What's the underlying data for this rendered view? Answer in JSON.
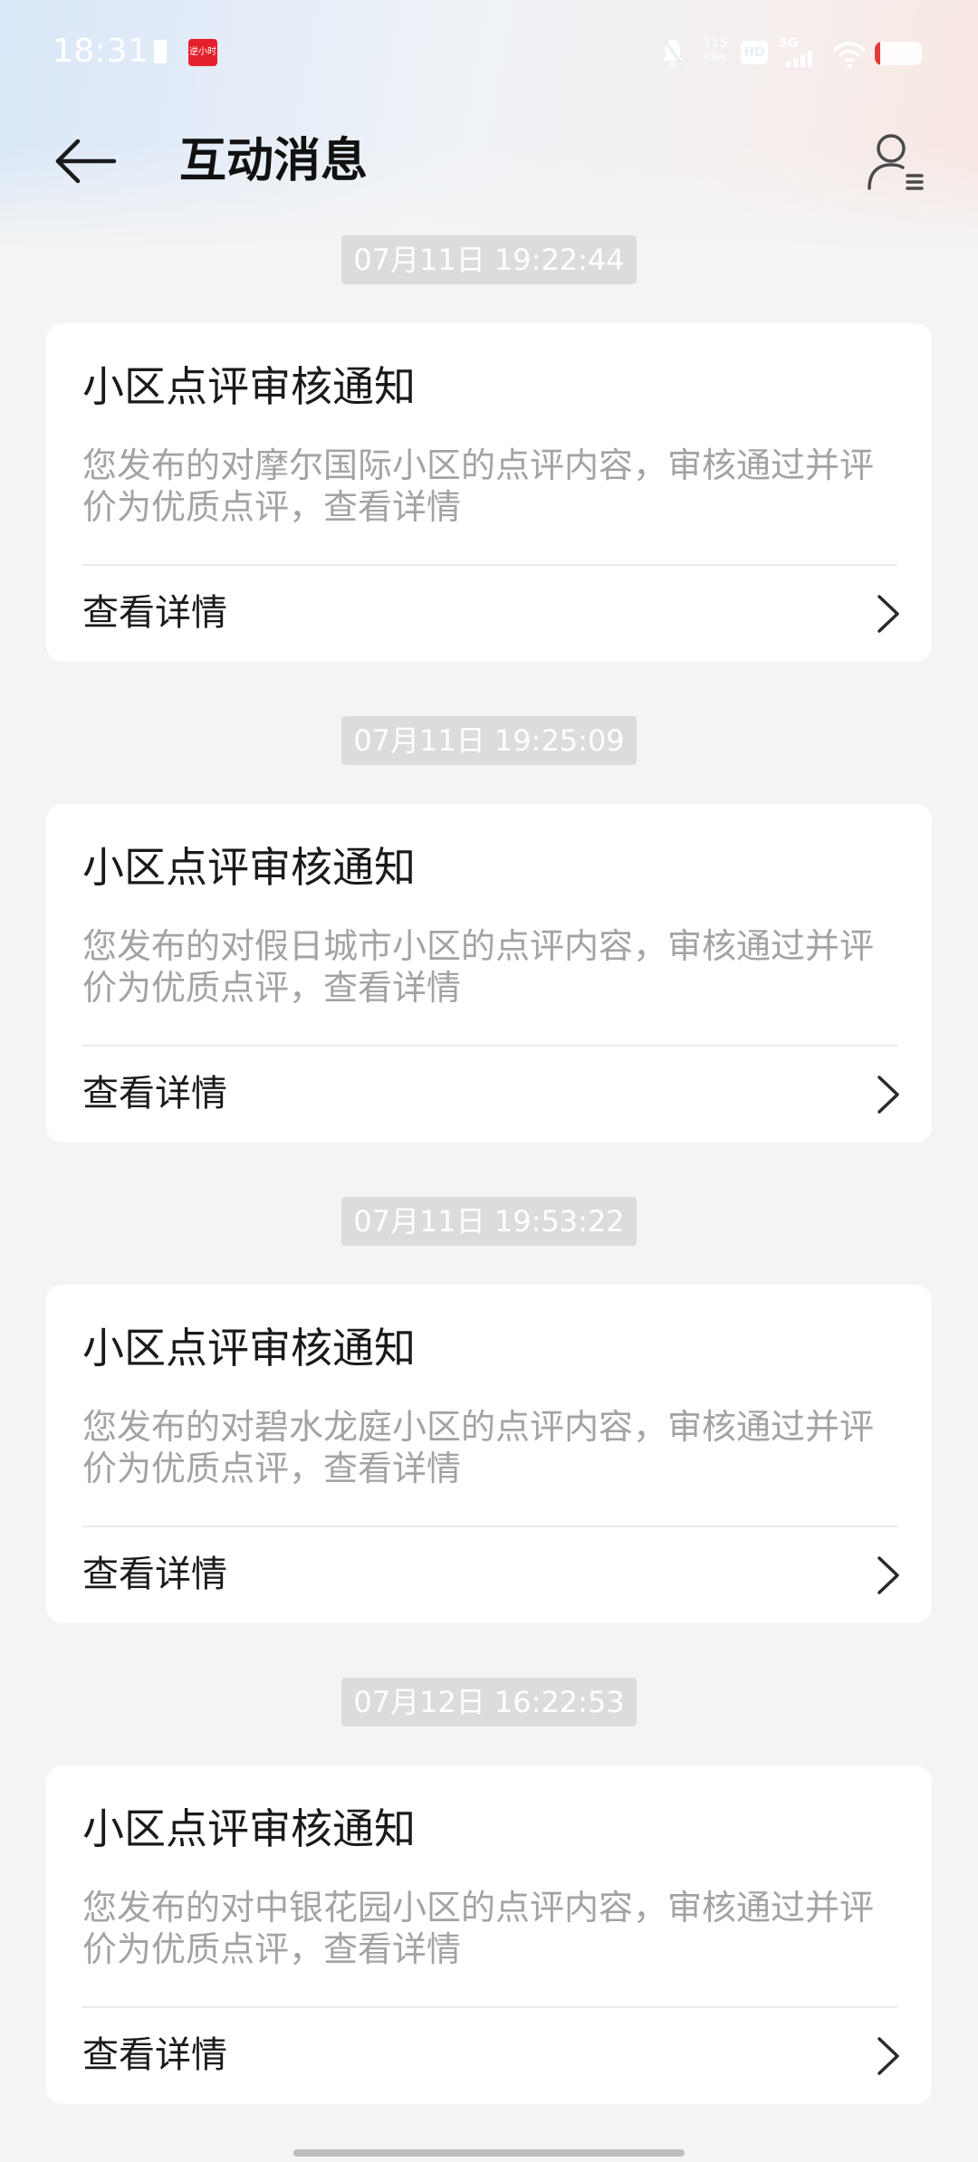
{
  "status_bar": {
    "time": "18:31",
    "app_badge": "逆小时",
    "net_speed_value": "115",
    "net_speed_unit": "KB/s",
    "hd_label": "HD",
    "network_label": "5G",
    "battery_level": 0.12
  },
  "header": {
    "title": "互动消息"
  },
  "messages": [
    {
      "timestamp": "07月11日 19:22:44",
      "title": "小区点评审核通知",
      "body": "您发布的对摩尔国际小区的点评内容，审核通过并评价为优质点评，查看详情",
      "action_label": "查看详情"
    },
    {
      "timestamp": "07月11日 19:25:09",
      "title": "小区点评审核通知",
      "body": "您发布的对假日城市小区的点评内容，审核通过并评价为优质点评，查看详情",
      "action_label": "查看详情"
    },
    {
      "timestamp": "07月11日 19:53:22",
      "title": "小区点评审核通知",
      "body": "您发布的对碧水龙庭小区的点评内容，审核通过并评价为优质点评，查看详情",
      "action_label": "查看详情"
    },
    {
      "timestamp": "07月12日 16:22:53",
      "title": "小区点评审核通知",
      "body": "您发布的对中银花园小区的点评内容，审核通过并评价为优质点评，查看详情",
      "action_label": "查看详情"
    }
  ],
  "colors": {
    "background": "#f4f4f4",
    "card": "#ffffff",
    "timestamp_bg": "#dcdcdc",
    "body_text": "#a3a3a3",
    "battery_low": "#e23a3a"
  }
}
